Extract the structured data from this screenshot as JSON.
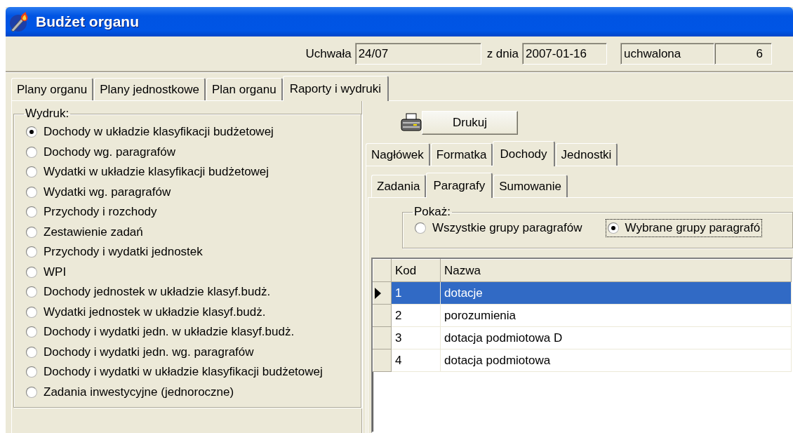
{
  "window": {
    "title": "Budżet organu"
  },
  "header": {
    "resolution_label": "Uchwała",
    "resolution": "24/07",
    "date_label": "z dnia",
    "date": "2007-01-16",
    "status": "uchwalona",
    "number": "6"
  },
  "tabs": [
    {
      "label": "Plany organu",
      "selected": false
    },
    {
      "label": "Plany jednostkowe",
      "selected": false
    },
    {
      "label": "Plan organu",
      "selected": false
    },
    {
      "label": "Raporty i wydruki",
      "selected": true
    }
  ],
  "printout": {
    "title": "Wydruk:",
    "options": [
      {
        "label": "Dochody w układzie klasyfikacji budżetowej",
        "selected": true
      },
      {
        "label": "Dochody wg. paragrafów",
        "selected": false
      },
      {
        "label": "Wydatki w układzie klasyfikacji budżetowej",
        "selected": false
      },
      {
        "label": "Wydatki wg. paragrafów",
        "selected": false
      },
      {
        "label": "Przychody i rozchody",
        "selected": false
      },
      {
        "label": "Zestawienie zadań",
        "selected": false
      },
      {
        "label": "Przychody i wydatki jednostek",
        "selected": false
      },
      {
        "label": "WPI",
        "selected": false
      },
      {
        "label": "Dochody jednostek w układzie klasyf.budż.",
        "selected": false
      },
      {
        "label": "Wydatki jednostek w układzie klasyf.budż.",
        "selected": false
      },
      {
        "label": "Dochody i wydatki jedn. w układzie klasyf.budż.",
        "selected": false
      },
      {
        "label": "Dochody i wydatki jedn. wg. paragrafów",
        "selected": false
      },
      {
        "label": "Dochody i wydatki w układzie klasyfikacji budżetowej",
        "selected": false
      },
      {
        "label": "Zadania inwestycyjne (jednoroczne)",
        "selected": false
      }
    ]
  },
  "print_button": "Drukuj",
  "report_tabs": [
    {
      "label": "Nagłówek",
      "selected": false
    },
    {
      "label": "Formatka",
      "selected": false
    },
    {
      "label": "Dochody",
      "selected": true
    },
    {
      "label": "Jednostki",
      "selected": false
    }
  ],
  "sub_tabs": [
    {
      "label": "Zadania",
      "selected": false
    },
    {
      "label": "Paragrafy",
      "selected": true
    },
    {
      "label": "Sumowanie",
      "selected": false
    }
  ],
  "show": {
    "title": "Pokaż:",
    "options": [
      {
        "label": "Wszystkie grupy paragrafów",
        "selected": false
      },
      {
        "label": "Wybrane grupy paragrafó",
        "selected": true
      }
    ]
  },
  "table": {
    "columns": [
      "Kod",
      "Nazwa"
    ],
    "rows": [
      {
        "cells": [
          "1",
          "dotacje"
        ],
        "selected": true
      },
      {
        "cells": [
          "2",
          "porozumienia"
        ],
        "selected": false
      },
      {
        "cells": [
          "3",
          "dotacja podmiotowa D"
        ],
        "selected": false
      },
      {
        "cells": [
          "4",
          "dotacja podmiotowa"
        ],
        "selected": false
      }
    ]
  }
}
